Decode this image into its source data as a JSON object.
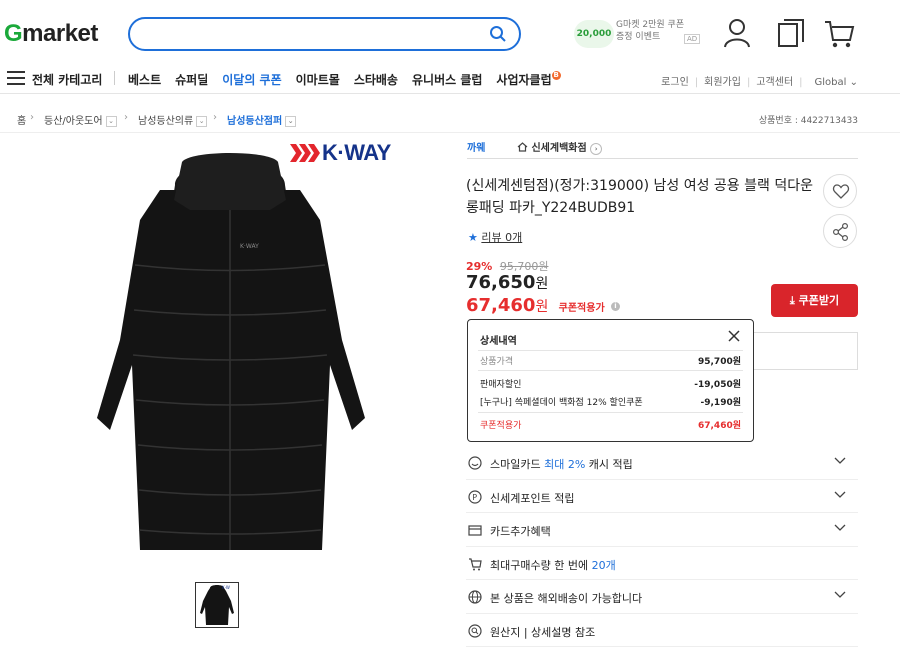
{
  "header": {
    "logo_g": "G",
    "logo_rest": "market",
    "search_placeholder": "",
    "promo_circle": "20,000",
    "promo_text": "G마켓 2만원 쿠폰 증정 이벤트",
    "promo_ad": "AD"
  },
  "nav": {
    "all_categories": "전체 카테고리",
    "items": [
      "베스트",
      "슈퍼딜",
      "이달의 쿠폰",
      "이마트몰",
      "스타배송",
      "유니버스 클럽",
      "사업자클럽"
    ],
    "badge": "B",
    "util": [
      "로그인",
      "회원가입",
      "고객센터",
      "Global"
    ]
  },
  "breadcrumb": {
    "home": "홈",
    "c1": "등산/아웃도어",
    "c2": "남성등산의류",
    "c3": "남성등산점퍼",
    "product_no": "상품번호 : 4422713433"
  },
  "brand_logo": "K·WAY",
  "product": {
    "brand": "까웨",
    "store": "신세계백화점",
    "title": "(신세계센텀점)(정가:319000) 남성 여성 공용 블랙 덕다운 롱패딩 파카_Y224BUDB91",
    "review": "리뷰 0개",
    "discount_pct": "29%",
    "original_price": "95,700원",
    "sale_price": "76,650",
    "coupon_price": "67,460",
    "won": "원",
    "coupon_applied": "쿠폰적용가",
    "coupon_button": "쿠폰받기"
  },
  "popup": {
    "title": "상세내역",
    "rows": [
      {
        "label": "상품가격",
        "value": "95,700원"
      },
      {
        "label": "판매자할인",
        "value": "-19,050원"
      },
      {
        "label": "[누구나] 쓱페셜데이 백화점 12% 할인쿠폰",
        "value": "-9,190원"
      },
      {
        "label": "쿠폰적용가",
        "value": "67,460원"
      }
    ]
  },
  "options": [
    {
      "icon": "smile-icon",
      "pre": "스마일카드 ",
      "blue": "최대 2%",
      "post": " 캐시 적립",
      "chevron": true
    },
    {
      "icon": "point-icon",
      "pre": "신세계포인트 적립",
      "blue": "",
      "post": "",
      "chevron": true
    },
    {
      "icon": "card-icon",
      "pre": "카드추가혜택",
      "blue": "",
      "post": "",
      "chevron": true
    },
    {
      "icon": "cart-small-icon",
      "pre": "최대구매수량 한 번에 ",
      "blue": "20개",
      "post": "",
      "chevron": false
    },
    {
      "icon": "globe-icon",
      "pre": "본 상품은 해외배송이 가능합니다",
      "blue": "",
      "post": "",
      "chevron": true
    },
    {
      "icon": "search-circle-icon",
      "pre": "원산지 | 상세설명 참조",
      "blue": "",
      "post": "",
      "chevron": false
    }
  ],
  "colors": {
    "accent_blue": "#1e6fd9",
    "price_red": "#e62e2e",
    "coupon_red": "#d9252b",
    "logo_green": "#1ba93a",
    "brand_navy": "#15338a"
  }
}
